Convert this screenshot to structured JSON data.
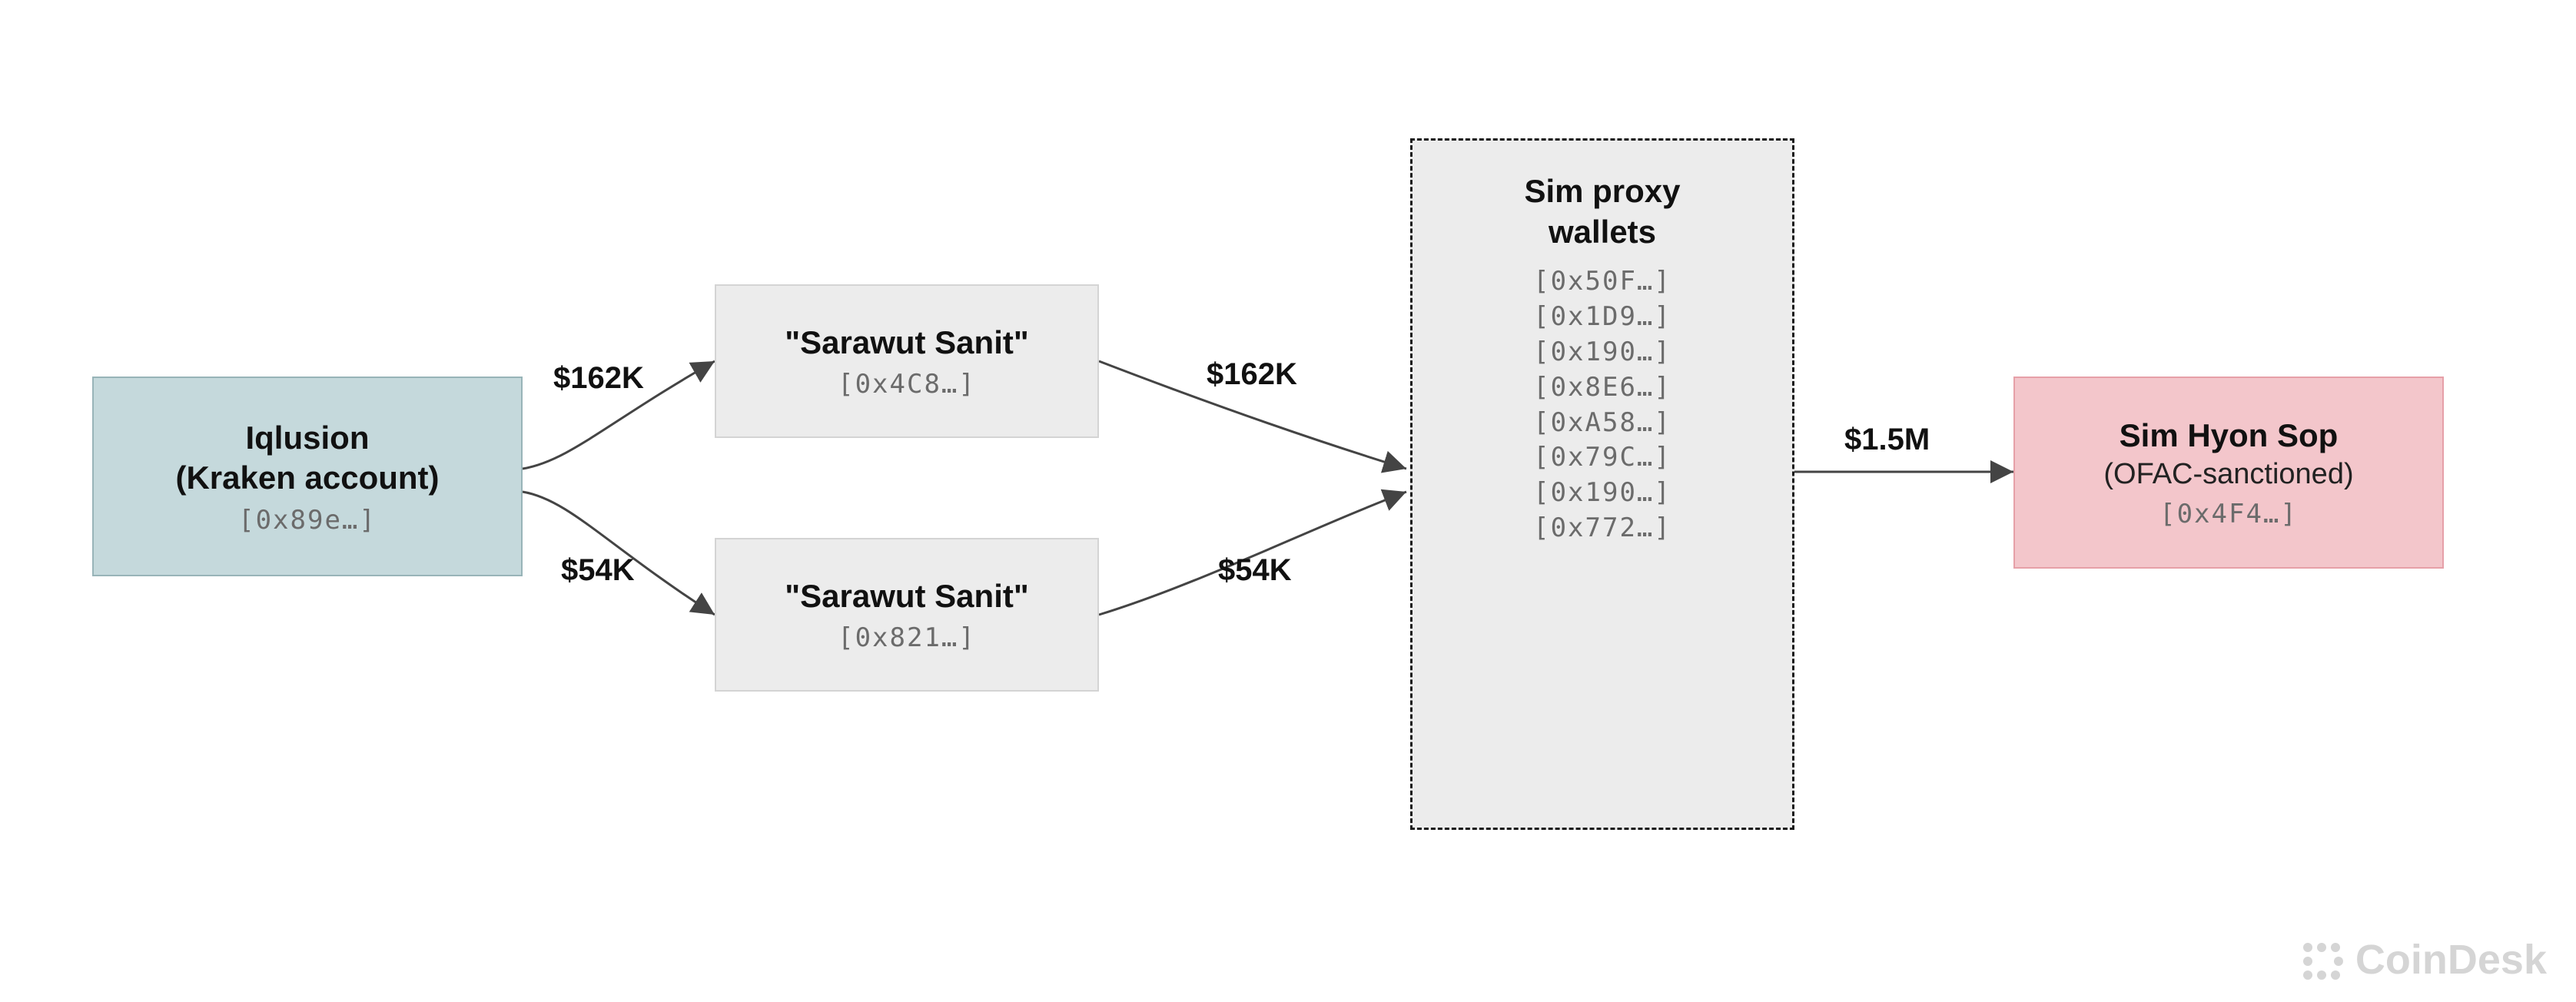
{
  "chart_data": {
    "type": "flow",
    "nodes": [
      {
        "id": "iqlusion",
        "title": "Iqlusion\n(Kraken account)",
        "address": "[0x89e…]",
        "style": "blue"
      },
      {
        "id": "sanit1",
        "title": "\"Sarawut Sanit\"",
        "address": "[0x4C8…]",
        "style": "gray"
      },
      {
        "id": "sanit2",
        "title": "\"Sarawut Sanit\"",
        "address": "[0x821…]",
        "style": "gray"
      },
      {
        "id": "proxy",
        "title": "Sim proxy\nwallets",
        "addresses": [
          "[0x50F…]",
          "[0x1D9…]",
          "[0x190…]",
          "[0x8E6…]",
          "[0xA58…]",
          "[0x79C…]",
          "[0x190…]",
          "[0x772…]"
        ],
        "style": "dashed"
      },
      {
        "id": "sim",
        "title": "Sim Hyon Sop",
        "subtitle": "(OFAC-sanctioned)",
        "address": "[0x4F4…]",
        "style": "pink"
      }
    ],
    "edges": [
      {
        "from": "iqlusion",
        "to": "sanit1",
        "label": "$162K"
      },
      {
        "from": "iqlusion",
        "to": "sanit2",
        "label": "$54K"
      },
      {
        "from": "sanit1",
        "to": "proxy",
        "label": "$162K"
      },
      {
        "from": "sanit2",
        "to": "proxy",
        "label": "$54K"
      },
      {
        "from": "proxy",
        "to": "sim",
        "label": "$1.5M"
      }
    ]
  },
  "nodes": {
    "iqlusion": {
      "title": "Iqlusion\n(Kraken account)",
      "addr": "[0x89e…]"
    },
    "sanit1": {
      "title": "\"Sarawut Sanit\"",
      "addr": "[0x4C8…]"
    },
    "sanit2": {
      "title": "\"Sarawut Sanit\"",
      "addr": "[0x821…]"
    },
    "proxy": {
      "title": "Sim proxy\nwallets",
      "addrs": "[0x50F…]\n[0x1D9…]\n[0x190…]\n[0x8E6…]\n[0xA58…]\n[0x79C…]\n[0x190…]\n[0x772…]"
    },
    "sim": {
      "title": "Sim Hyon Sop",
      "subtitle": "(OFAC-sanctioned)",
      "addr": "[0x4F4…]"
    }
  },
  "amounts": {
    "iq_to_s1": "$162K",
    "iq_to_s2": "$54K",
    "s1_to_proxy": "$162K",
    "s2_to_proxy": "$54K",
    "proxy_to_sim": "$1.5M"
  },
  "watermark": {
    "text": "CoinDesk"
  }
}
